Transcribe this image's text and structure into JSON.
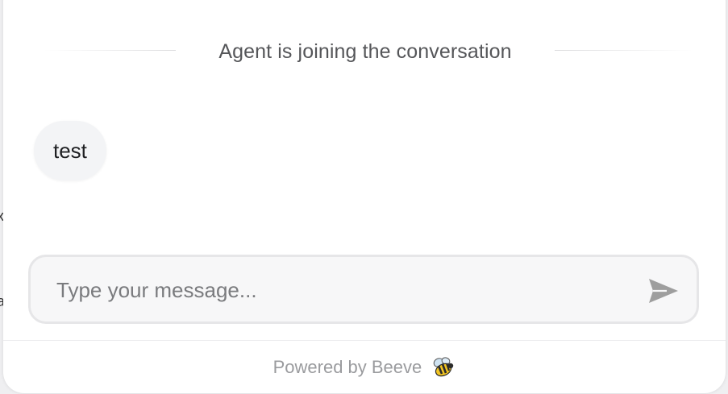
{
  "background_fragments": [
    "x",
    ":",
    "a"
  ],
  "system_message": {
    "text": "Agent is joining the conversation"
  },
  "messages": [
    {
      "text": "test"
    }
  ],
  "composer": {
    "placeholder": "Type your message...",
    "value": "",
    "send_icon": "send-icon"
  },
  "footer": {
    "label": "Powered by Beeve",
    "icon": "bee-icon"
  },
  "colors": {
    "panel_bg": "#ffffff",
    "bubble_bg": "#f3f4f6",
    "input_bg": "#f7f7f8",
    "send_icon": "#9e9e9e",
    "muted_text": "#9a9b9e"
  }
}
